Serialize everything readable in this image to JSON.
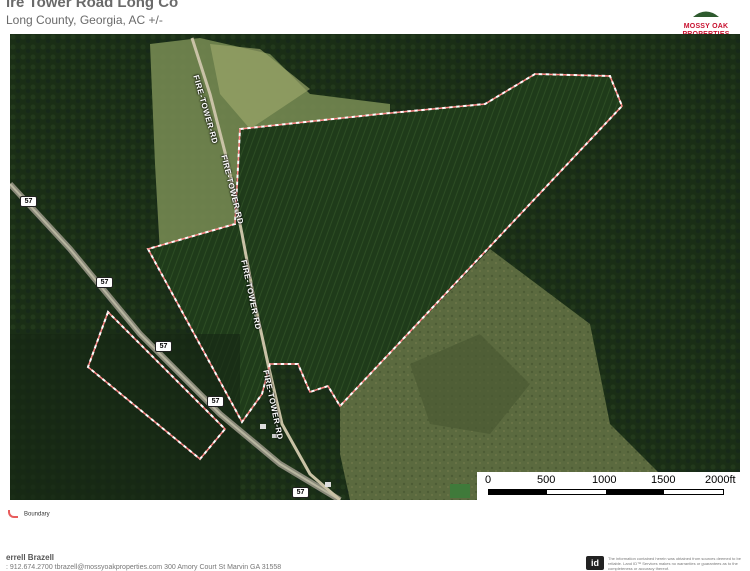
{
  "header": {
    "title": "ire Tower Road Long Co",
    "subtitle": "Long County, Georgia,  AC +/-"
  },
  "logo": {
    "brand_line1": "MOSSY OAK",
    "brand_line2": "PROPERTIES",
    "tagline": "Coastal Land and Real Estate",
    "tagline2": "America's Land Specialist"
  },
  "map": {
    "road_labels": [
      "FIRE-TOWER-RD",
      "FIRE-TOWER-RD",
      "FIRE-TOWER-RD",
      "FIRE-TOWER-RD"
    ],
    "highway_shields": [
      "57",
      "57",
      "57",
      "57",
      "57"
    ],
    "boundary_color": "#ff8a8a"
  },
  "scale": {
    "labels": [
      "0",
      "500",
      "1000",
      "1500",
      "2000ft"
    ]
  },
  "legend": {
    "boundary_label": "Boundary"
  },
  "footer": {
    "name": "errell Brazell",
    "contact_line": ": 912.674.2700       tbrazell@mossyoakproperties.com       300 Amory Court St Marvin GA 31558",
    "disclaimer": "The information contained herein was obtained from sources deemed to be reliable. Land ID™ Services makes no warranties or guarantees as to the completeness or accuracy thereof.",
    "disclaimer_logo": "id"
  }
}
